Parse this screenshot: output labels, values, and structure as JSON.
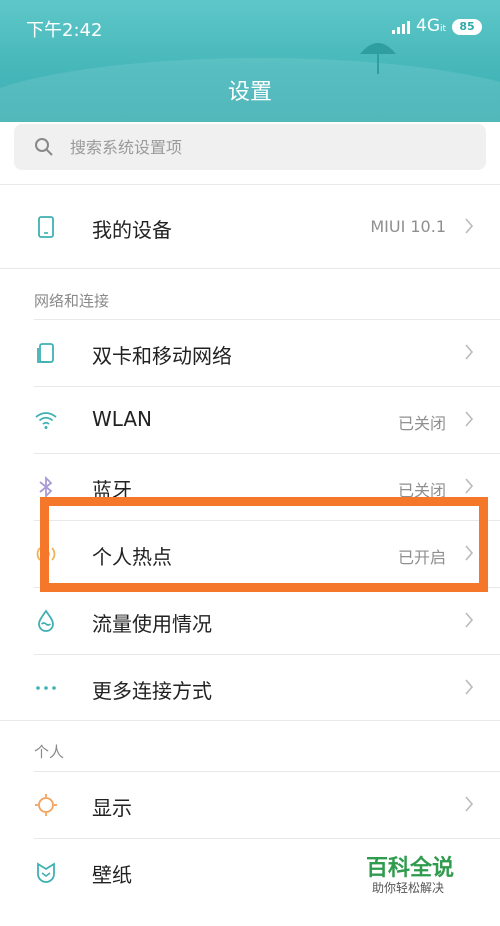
{
  "status_bar": {
    "time": "下午2:42",
    "network": "4G",
    "network_sub": "it",
    "battery": "85"
  },
  "header": {
    "title": "设置"
  },
  "search": {
    "placeholder": "搜索系统设置项"
  },
  "my_device": {
    "label": "我的设备",
    "value": "MIUI 10.1",
    "icon": "phone-icon"
  },
  "sections": {
    "network": "网络和连接",
    "personal": "个人"
  },
  "network_items": [
    {
      "label": "双卡和移动网络",
      "value": "",
      "icon": "sim-card-icon"
    },
    {
      "label": "WLAN",
      "value": "已关闭",
      "icon": "wifi-icon"
    },
    {
      "label": "蓝牙",
      "value": "已关闭",
      "icon": "bluetooth-icon"
    },
    {
      "label": "个人热点",
      "value": "已开启",
      "icon": "hotspot-icon"
    },
    {
      "label": "流量使用情况",
      "value": "",
      "icon": "data-usage-icon"
    },
    {
      "label": "更多连接方式",
      "value": "",
      "icon": "more-dots-icon"
    }
  ],
  "personal_items": [
    {
      "label": "显示",
      "value": "",
      "icon": "brightness-icon"
    },
    {
      "label": "壁纸",
      "value": "",
      "icon": "wallpaper-icon"
    }
  ],
  "watermark": {
    "title": "百科全说",
    "subtitle": "助你轻松解决"
  },
  "colors": {
    "header": "#45b6b9",
    "accent_icon": "#3fb0b3",
    "highlight_box": "#f5782a",
    "watermark": "#2f9b4d"
  }
}
